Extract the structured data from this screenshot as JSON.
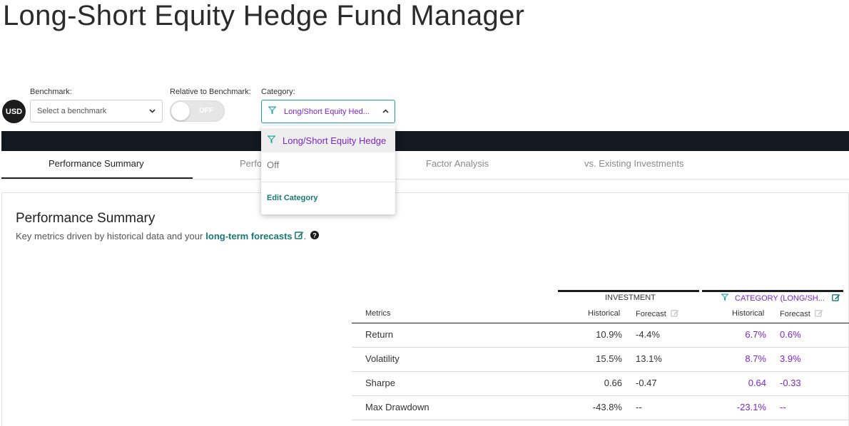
{
  "page": {
    "title": "Long-Short Equity Hedge Fund Manager"
  },
  "controls": {
    "currency": "USD",
    "benchmark_label": "Benchmark:",
    "benchmark_placeholder": "Select a benchmark",
    "relative_label": "Relative to Benchmark:",
    "relative_toggle_text": "OFF",
    "category_label": "Category:",
    "category_value": "Long/Short Equity Hed..."
  },
  "category_dropdown": {
    "options": [
      "Long/Short Equity Hedge",
      "Off"
    ],
    "edit_label": "Edit Category"
  },
  "tabs": [
    {
      "label": "Performance Summary",
      "active": true
    },
    {
      "label": "Perfo",
      "active": false
    },
    {
      "label": "Factor Analysis",
      "active": false
    },
    {
      "label": "vs. Existing Investments",
      "active": false
    }
  ],
  "summary": {
    "title": "Performance Summary",
    "subtitle_prefix": "Key metrics driven by historical data and your",
    "subtitle_link": "long-term forecasts",
    "subtitle_suffix": "."
  },
  "table": {
    "investment_group": "INVESTMENT",
    "category_group": "CATEGORY (LONG/SH...",
    "metrics_header": "Metrics",
    "historical_header": "Historical",
    "forecast_header": "Forecast",
    "rows": [
      {
        "metric": "Return",
        "inv_hist": "10.9%",
        "inv_fc": "-4.4%",
        "cat_hist": "6.7%",
        "cat_fc": "0.6%"
      },
      {
        "metric": "Volatility",
        "inv_hist": "15.5%",
        "inv_fc": "13.1%",
        "cat_hist": "8.7%",
        "cat_fc": "3.9%"
      },
      {
        "metric": "Sharpe",
        "inv_hist": "0.66",
        "inv_fc": "-0.47",
        "cat_hist": "0.64",
        "cat_fc": "-0.33"
      },
      {
        "metric": "Max Drawdown",
        "inv_hist": "-43.8%",
        "inv_fc": "--",
        "cat_hist": "-23.1%",
        "cat_fc": "--"
      }
    ]
  },
  "colors": {
    "accent_teal": "#167a73",
    "category_purple": "#7b26c9",
    "dark_bar": "#141820"
  },
  "icons": [
    "funnel-icon",
    "chevron-down-icon",
    "chevron-up-icon",
    "edit-icon",
    "help-icon"
  ]
}
